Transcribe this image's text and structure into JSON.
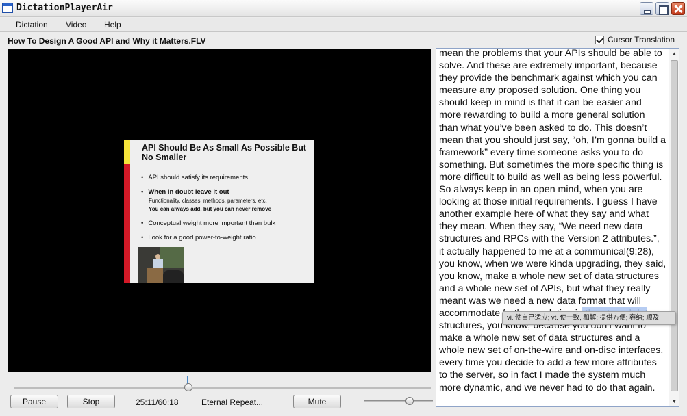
{
  "window": {
    "title": "DictationPlayerAir"
  },
  "menu": {
    "items": [
      "Dictation",
      "Video",
      "Help"
    ]
  },
  "file_title": "How To Design A Good API and Why it Matters.FLV",
  "cursor_translation": {
    "label": "Cursor Translation",
    "checked": true
  },
  "video": {
    "slide": {
      "title": "API Should Be As Small As Possible But No Smaller",
      "bullets": [
        "API should satisfy its requirements",
        "When in doubt leave it out",
        "Conceptual weight more important than bulk",
        "Look for a good power-to-weight ratio"
      ],
      "sub_bullets": [
        "Functionality, classes, methods, parameters, etc.",
        "You can always add, but you can never remove"
      ]
    }
  },
  "controls": {
    "pause_label": "Pause",
    "stop_label": "Stop",
    "time": "25:11/60:18",
    "repeat_mode": "Eternal Repeat...",
    "mute_label": "Mute"
  },
  "transcript": {
    "text": "mean the problems that your APIs should be able to solve. And these are extremely important, because they provide the benchmark against which you can measure any proposed solution. One thing you should keep in mind is that it can be easier and more rewarding to build a more general solution than what you’ve been asked to do. This doesn’t mean that you should just say, “oh, I’m gonna build a framework” every time someone asks you to do something. But sometimes the more specific thing is more difficult to build as well as being less powerful. So always keep in an open mind, when you are looking at those initial requirements. I guess I have another example here of what they say and what they mean. When they say, “We need new data structures and RPCs with the Version 2 attributes.”, it actually happened to me at a communical(9:28), you know, when we were kinda upgrading, they said, you know, make a whole new set of data structures and a whole new set of APIs, but what they really meant was we need a new data format that will accommodate further evolution in the eternal data structures, you know, because you don’t want to make a whole new set of data structures and a whole new set of on-the-wire and on-disc interfaces, every time you decide to add a few more attributes to the server, so in fact I made the system much more dynamic, and we never had to do that again."
  },
  "translation_tooltip": {
    "text": "vi. 使自己适应; vt. 使一致, 和解; 提供方便; 容纳; 顺及"
  }
}
